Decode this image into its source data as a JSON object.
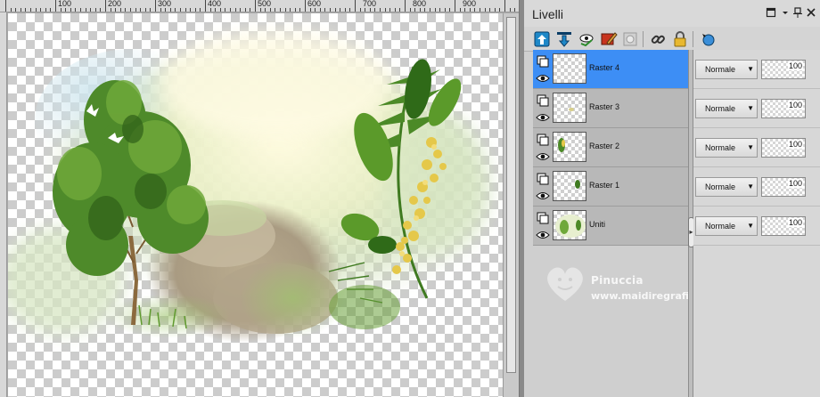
{
  "ruler": {
    "labels": [
      "100",
      "200",
      "300",
      "400",
      "500",
      "600",
      "700",
      "800",
      "900"
    ]
  },
  "panel": {
    "title": "Livelli",
    "header_buttons": [
      "restore-icon",
      "dropdown-icon",
      "pin-icon",
      "close-icon"
    ]
  },
  "toolbar": {
    "icons": [
      "new-raster-layer-icon",
      "new-vector-layer-icon",
      "visibility-toggle-icon",
      "edit-layer-icon",
      "mask-icon",
      "link-icon",
      "lock-icon",
      "layer-group-icon"
    ]
  },
  "layers": [
    {
      "name": "Raster 4",
      "blend": "Normale",
      "opacity": "100",
      "selected": true
    },
    {
      "name": "Raster 3",
      "blend": "Normale",
      "opacity": "100",
      "selected": false
    },
    {
      "name": "Raster 2",
      "blend": "Normale",
      "opacity": "100",
      "selected": false
    },
    {
      "name": "Raster 1",
      "blend": "Normale",
      "opacity": "100",
      "selected": false
    },
    {
      "name": "Uniti",
      "blend": "Normale",
      "opacity": "100",
      "selected": false
    }
  ],
  "watermark": {
    "name": "Pinuccia",
    "url": "www.maidiregrafica.eu"
  },
  "colors": {
    "selected_layer": "#3d8ef5",
    "panel_bg": "#cfcfcf",
    "layer_bg": "#b8b8b8"
  }
}
